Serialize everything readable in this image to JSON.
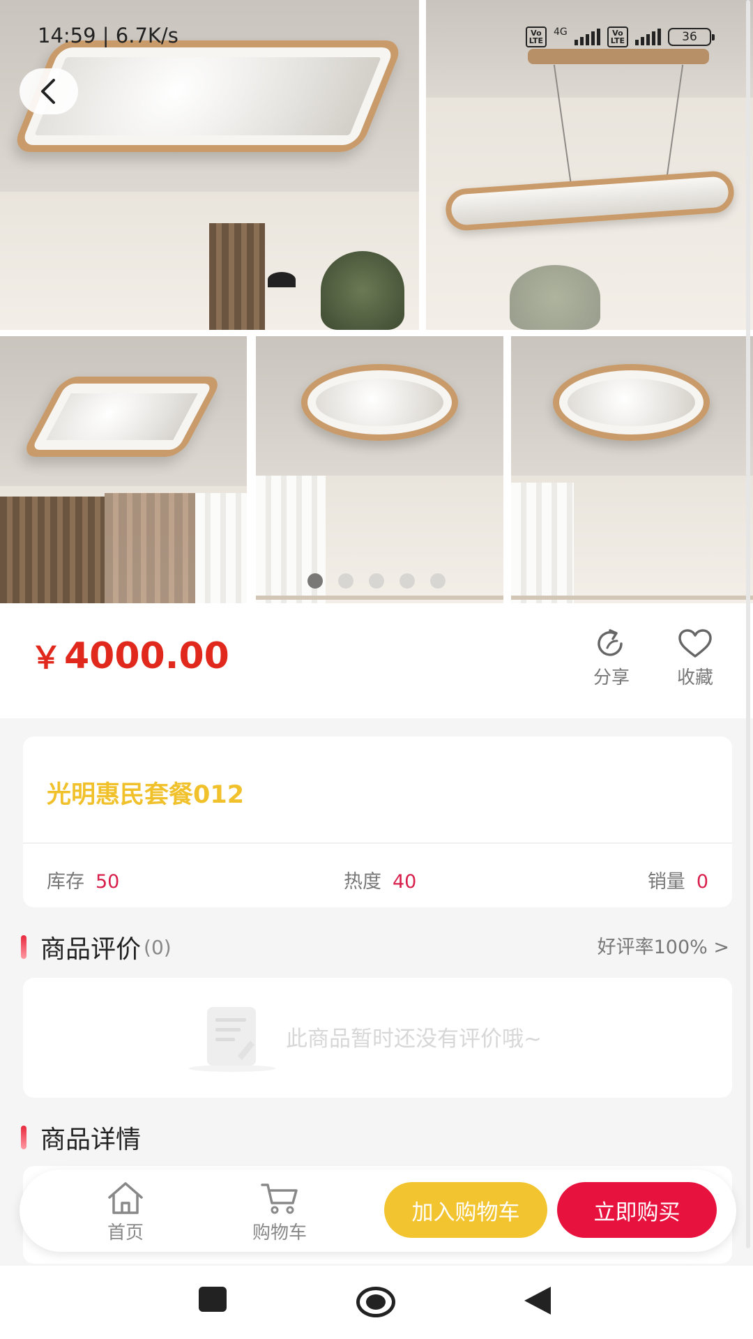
{
  "status_bar": {
    "time_speed": "14:59 | 6.7K/s",
    "network": "4G",
    "volte": "Vo LTE",
    "battery": "36"
  },
  "gallery": {
    "page_count": 5,
    "active_index": 0
  },
  "product": {
    "price": "4000.00",
    "currency_symbol": "￥",
    "title": "光明惠民套餐012",
    "stock_label": "库存",
    "stock_value": "50",
    "heat_label": "热度",
    "heat_value": "40",
    "sales_label": "销量",
    "sales_value": "0"
  },
  "actions": {
    "share_label": "分享",
    "favorite_label": "收藏"
  },
  "reviews": {
    "heading": "商品评价",
    "count": "(0)",
    "rating_link": "好评率100% >",
    "empty_text": "此商品暂时还没有评价哦~"
  },
  "details": {
    "heading": "商品详情"
  },
  "bottom_bar": {
    "home_label": "首页",
    "cart_label": "购物车",
    "add_to_cart_label": "加入购物车",
    "buy_now_label": "立即购买"
  },
  "colors": {
    "price": "#e1281c",
    "title": "#f1c12c",
    "stat_value": "#d81e4a",
    "add_to_cart": "#f2c530",
    "buy_now": "#e8123e"
  }
}
